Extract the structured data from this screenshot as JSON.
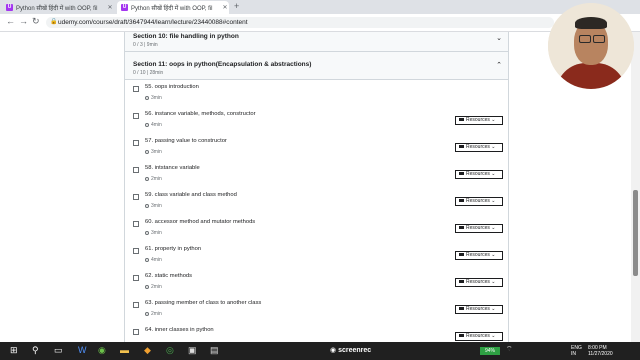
{
  "browser": {
    "tabs": [
      {
        "title": "Python सीखें हिंदी में with OOP, fil",
        "favicon": "Ü",
        "active": false
      },
      {
        "title": "Python सीखें हिंदी में with OOP, fil",
        "favicon": "Ü",
        "active": true
      }
    ],
    "new_tab": "+",
    "url": "udemy.com/course/draft/3647944/learn/lecture/23440088#content"
  },
  "curriculum": {
    "section10": {
      "title": "Section 10: file handling in python",
      "meta": "0 / 3 | 9min",
      "chevron": "⌄"
    },
    "section11": {
      "title": "Section 11: oops in python(Encapsulation & abstractions)",
      "meta": "0 / 10 | 28min",
      "chevron": "⌃"
    },
    "resources_label": "Resources",
    "lectures": [
      {
        "title": "55. oops introduction",
        "duration": "3min",
        "resources": false
      },
      {
        "title": "56. instance variable, methods, constructor",
        "duration": "4min",
        "resources": true
      },
      {
        "title": "57. passing value to constructor",
        "duration": "3min",
        "resources": true
      },
      {
        "title": "58. intstance variable",
        "duration": "2min",
        "resources": true
      },
      {
        "title": "59. class variable and class method",
        "duration": "3min",
        "resources": true
      },
      {
        "title": "60. accessor method and mutator methods",
        "duration": "3min",
        "resources": true
      },
      {
        "title": "61. property in python",
        "duration": "4min",
        "resources": true
      },
      {
        "title": "62. static methods",
        "duration": "2min",
        "resources": true
      },
      {
        "title": "63. passing member of class to another class",
        "duration": "2min",
        "resources": true
      },
      {
        "title": "64. inner classes in python",
        "duration": "",
        "resources": true
      }
    ]
  },
  "taskbar": {
    "screenrec": "screenrec",
    "battery": "94%",
    "lang": "ENG",
    "region": "IN",
    "time": "8:00 PM",
    "date": "11/27/2020"
  },
  "colors": {
    "accent": "#a435f0",
    "taskbar": "#202020",
    "section_bg": "#f7f9fa"
  }
}
